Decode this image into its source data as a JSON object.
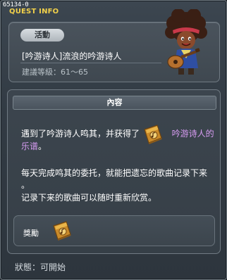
{
  "window": {
    "quest_id": "65134-0",
    "title": "QUEST INFO"
  },
  "info": {
    "category": "活動",
    "quest_name": "[吟游诗人]流浪的吟游诗人",
    "level_range": "建議等級：61～65"
  },
  "content": {
    "header": "內容",
    "line1_before": "遇到了吟游诗人鸣其，并获得了",
    "line1_item": "吟游诗人的",
    "line2_item": "乐谱",
    "line2_after": "。",
    "para2_line1": "每天完成鸣其的委托，就能把遗忘的歌曲记录下来",
    "para2_line2": "。",
    "para3": "记录下来的歌曲可以随时重新欣赏。"
  },
  "reward": {
    "label": "獎勵",
    "item_icon": "music-sheet-book-icon"
  },
  "status": {
    "text": "狀態：可開始"
  },
  "colors": {
    "title": "#f2d14a",
    "highlight": "#d79cf2",
    "panel_border": "#717b84"
  }
}
